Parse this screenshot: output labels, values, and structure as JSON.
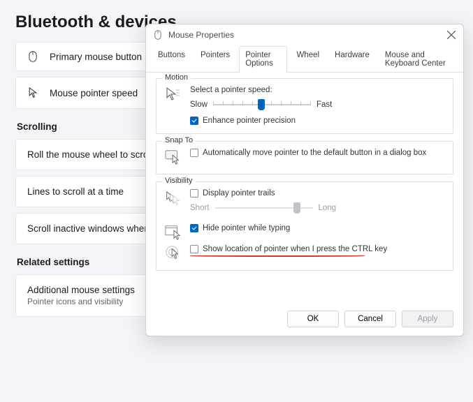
{
  "bg": {
    "title": "Bluetooth & devices",
    "card1": "Primary mouse button",
    "card2": "Mouse pointer speed",
    "section_scroll": "Scrolling",
    "card3": "Roll the mouse wheel to scroll",
    "card4": "Lines to scroll at a time",
    "card5": "Scroll inactive windows when",
    "section_related": "Related settings",
    "card6": "Additional mouse settings",
    "card6_sub": "Pointer icons and visibility"
  },
  "dialog": {
    "title": "Mouse Properties",
    "tabs": [
      "Buttons",
      "Pointers",
      "Pointer Options",
      "Wheel",
      "Hardware",
      "Mouse and Keyboard Center"
    ],
    "active_tab": 2,
    "motion": {
      "title": "Motion",
      "select_label": "Select a pointer speed:",
      "slow": "Slow",
      "fast": "Fast",
      "enhance": "Enhance pointer precision"
    },
    "snap": {
      "title": "Snap To",
      "auto": "Automatically move pointer to the default button in a dialog box"
    },
    "visibility": {
      "title": "Visibility",
      "trails": "Display pointer trails",
      "short": "Short",
      "long": "Long",
      "hide": "Hide pointer while typing",
      "ctrl": "Show location of pointer when I press the CTRL key"
    },
    "buttons": {
      "ok": "OK",
      "cancel": "Cancel",
      "apply": "Apply"
    }
  }
}
